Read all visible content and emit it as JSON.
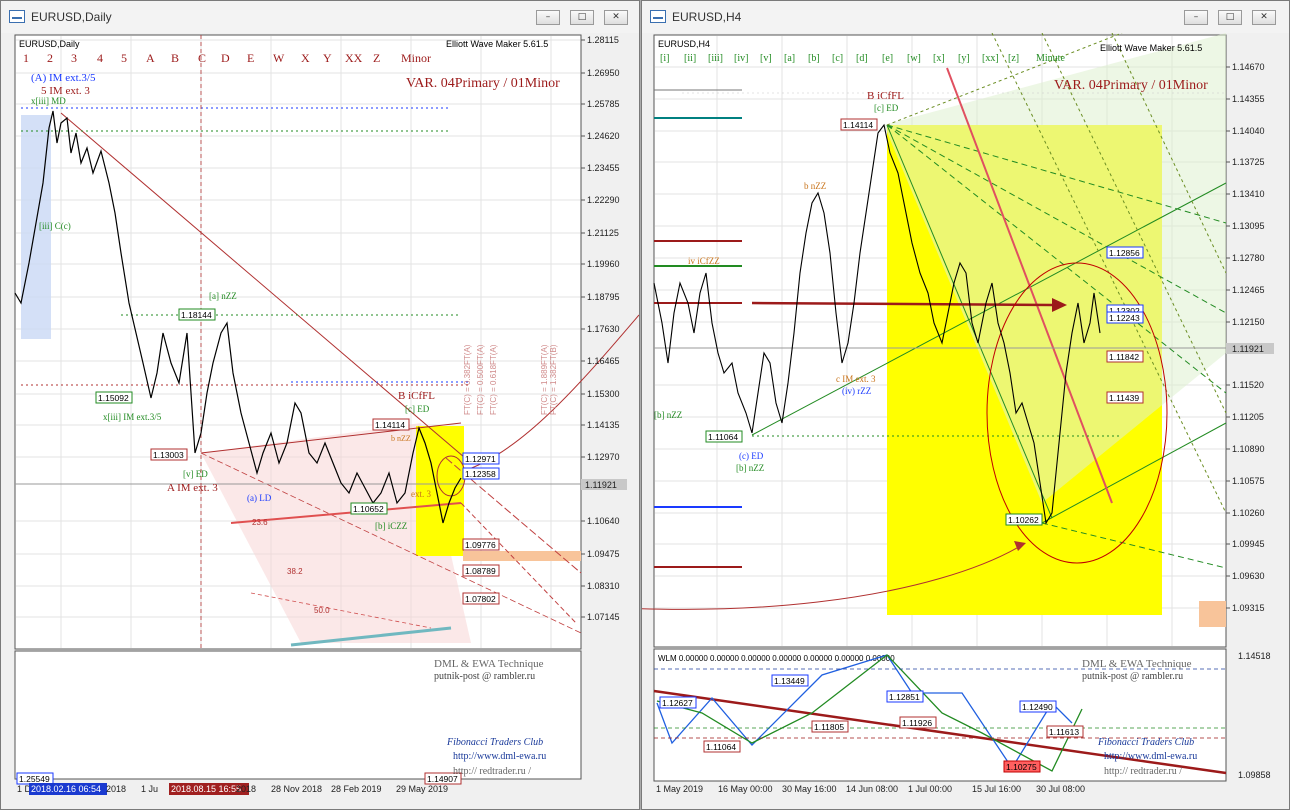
{
  "left_window": {
    "title": "EURUSD,Daily",
    "chart_label": "EURUSD,Daily",
    "indicator": "Elliott Wave Maker 5.61.5",
    "variant": "VAR. 04Primary / 01Minor",
    "wave_selector": [
      "1",
      "2",
      "3",
      "4",
      "5",
      "A",
      "B",
      "C",
      "D",
      "E",
      "W",
      "X",
      "Y",
      "XX",
      "Z",
      "Minor"
    ],
    "price_axis": [
      "1.28115",
      "1.26950",
      "1.25785",
      "1.24620",
      "1.23455",
      "1.22290",
      "1.21125",
      "1.19960",
      "1.18795",
      "1.17630",
      "1.16465",
      "1.15300",
      "1.14135",
      "1.12970",
      "1.11921",
      "1.10640",
      "1.09475",
      "1.08310",
      "1.07145"
    ],
    "time_axis": [
      "1 D",
      "2018.02.16 06:54",
      "2018",
      "1 Ju",
      "2018.08.15 16:55",
      "2018",
      "28 Nov 2018",
      "28 Feb 2019",
      "29 May 2019"
    ],
    "boxes": [
      "1.18144",
      "1.15092",
      "1.13003",
      "1.10652",
      "1.14114",
      "1.12971",
      "1.12358",
      "1.09776",
      "1.08789",
      "1.07802",
      "1.25549",
      "1.14907"
    ],
    "labels": {
      "im_ext35": "(A) IM ext.3/5",
      "im_ext3_5": "5 IM ext. 3",
      "x_iii": "x[iii] MD",
      "iii_c": "[iii] C(c)",
      "x_iii_im": "x[iii] IM ext.3/5",
      "a_nzz": "[a] nZZ",
      "v_ed": "[v] ED",
      "a_im_ext3": "A IM ext. 3",
      "a_ld": "(a) LD",
      "b_icffl": "B iCfFL",
      "c_ed": "[c] ED",
      "b_nzz": "b nZZ",
      "b_iczz": "[b] iCZZ",
      "ext3": "ext. 3",
      "ft382": "FT(C) = 0.382FT(A)",
      "ft500": "FT(C) = 0.500FT(A)",
      "ft618": "FT(C) = 0.618FT(A)",
      "ft1889": "FT(C) = 1.889FT(A)",
      "ft1382": "FT(C) = 1.382FT(B)",
      "fib236": "23.6",
      "fib382": "38.2",
      "fib500": "50.0"
    },
    "footer": {
      "technique": "DML & EWA Technique",
      "email": "putnik-post @ rambler.ru",
      "club": "Fibonacci Traders Club",
      "url1": "http://www.dml-ewa.ru",
      "url2": "http:// redtrader.ru /"
    }
  },
  "right_window": {
    "title": "EURUSD,H4",
    "chart_label": "EURUSD,H4",
    "indicator": "Elliott Wave Maker 5.61.5",
    "variant": "VAR. 04Primary / 01Minor",
    "wave_selector": [
      "[i]",
      "[ii]",
      "[iii]",
      "[iv]",
      "[v]",
      "[a]",
      "[b]",
      "[c]",
      "[d]",
      "[e]",
      "[w]",
      "[x]",
      "[y]",
      "[xx]",
      "[z]",
      "Minute"
    ],
    "price_axis": [
      "1.14670",
      "1.14355",
      "1.14040",
      "1.13725",
      "1.13410",
      "1.13095",
      "1.12780",
      "1.12465",
      "1.12150",
      "1.11921",
      "1.11520",
      "1.11205",
      "1.10890",
      "1.10575",
      "1.10260",
      "1.09945",
      "1.09630",
      "1.09315"
    ],
    "wlm_axis": [
      "1.14518",
      "1.09858"
    ],
    "time_axis": [
      "1 May 2019",
      "16 May 00:00",
      "30 May 16:00",
      "14 Jun 08:00",
      "1 Jul 00:00",
      "15 Jul 16:00",
      "30 Jul 08:00"
    ],
    "boxes": [
      "1.14114",
      "1.11064",
      "1.10262",
      "1.12856",
      "1.12302",
      "1.12243",
      "1.11842",
      "1.11439"
    ],
    "labels": {
      "b_icffl": "B iCfFL",
      "c_ed": "[c] ED",
      "b_nzz": "b nZZ",
      "iv_icfzz": "iv iCfZZ",
      "b_nzz2": "[b] nZZ",
      "c_ed2": "(c) ED",
      "b_nzz3": "[b] nZZ",
      "c_im": "c IM ext. 3",
      "iv_rzz": "(iv) rZZ"
    },
    "wlm": {
      "header": "WLM 0.00000 0.00000 0.00000 0.00000 0.00000 0.00000 0.00000",
      "boxes": [
        "1.12627",
        "1.13449",
        "1.12851",
        "1.12490",
        "1.11805",
        "1.11926",
        "1.11613",
        "1.11064",
        "1.10275"
      ]
    },
    "footer": {
      "technique": "DML & EWA Technique",
      "email": "putnik-post @ rambler.ru",
      "club": "Fibonacci Traders Club",
      "url1": "http://www.dml-ewa.ru",
      "url2": "http:// redtrader.ru /"
    }
  },
  "window_buttons": {
    "minimize": "–",
    "maximize": "□",
    "close": "✕"
  },
  "colors": {
    "bull_yellow": "#ffff00",
    "red": "#c00000",
    "green": "#228b22",
    "blue": "#1a3aff",
    "grid": "#dcdcdc"
  }
}
